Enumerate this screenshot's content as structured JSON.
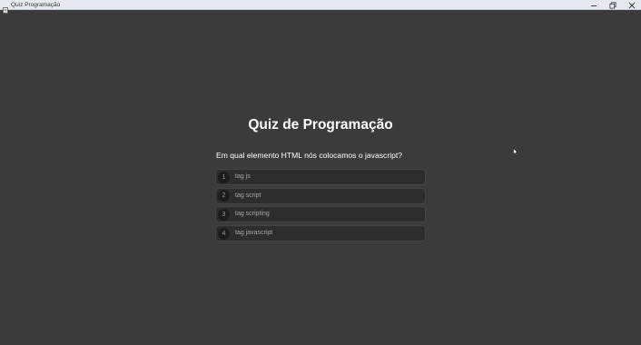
{
  "window": {
    "title": "Quiz Programação"
  },
  "quiz": {
    "title": "Quiz de Programação",
    "question": "Em qual elemento HTML nós colocamos o javascript?",
    "answers": [
      {
        "number": "1",
        "label": "tag js"
      },
      {
        "number": "2",
        "label": "tag script"
      },
      {
        "number": "3",
        "label": "tag scripting"
      },
      {
        "number": "4",
        "label": "tag javascript"
      }
    ]
  },
  "icons": {
    "app": "document-icon",
    "minimize": "minimize-icon",
    "maximize": "maximize-icon",
    "close": "close-icon",
    "cursor": "mouse-pointer-icon"
  },
  "colors": {
    "background": "#3b3b3b",
    "titlebar": "#e6e9ef",
    "answer_bg": "#2d2d2d",
    "number_bg": "#1c1c1c",
    "text": "#ffffff"
  }
}
